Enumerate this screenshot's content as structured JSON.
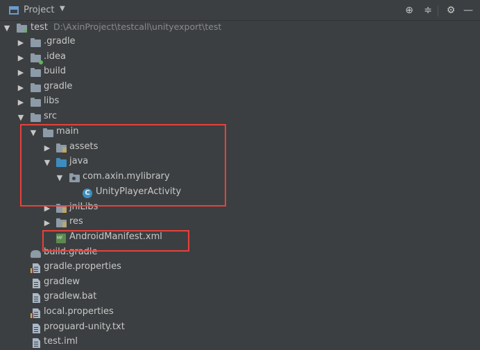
{
  "header": {
    "title": "Project",
    "icons": [
      "project-view-icon",
      "dropdown-caret-icon",
      "locate-icon",
      "collapse-all-icon",
      "settings-gear-icon",
      "hide-panel-icon"
    ],
    "locate_glyph": "⊕",
    "collapse_glyph": "≑",
    "gear_glyph": "⚙",
    "hide_glyph": "—",
    "caret_glyph": "▼"
  },
  "tree": {
    "root": {
      "label": "test",
      "path": "D:\\AxinProject\\testcall\\unityexport\\test"
    },
    "items": [
      {
        "label": ".gradle"
      },
      {
        "label": ".idea"
      },
      {
        "label": "build"
      },
      {
        "label": "gradle"
      },
      {
        "label": "libs"
      },
      {
        "label": "src"
      },
      {
        "label": "main"
      },
      {
        "label": "assets"
      },
      {
        "label": "java"
      },
      {
        "label": "com.axin.mylibrary"
      },
      {
        "label": "UnityPlayerActivity"
      },
      {
        "label": "jniLibs"
      },
      {
        "label": "res"
      },
      {
        "label": "AndroidManifest.xml"
      },
      {
        "label": "build.gradle"
      },
      {
        "label": "gradle.properties"
      },
      {
        "label": "gradlew"
      },
      {
        "label": "gradlew.bat"
      },
      {
        "label": "local.properties"
      },
      {
        "label": "proguard-unity.txt"
      },
      {
        "label": "test.iml"
      }
    ],
    "expanded_arrow": "▼",
    "collapsed_arrow": "▶",
    "class_letter": "C"
  },
  "colors": {
    "background": "#3c3f41",
    "highlight_border": "#e8413c",
    "folder": "#8d9aa7",
    "source_folder": "#3d8cc0"
  }
}
